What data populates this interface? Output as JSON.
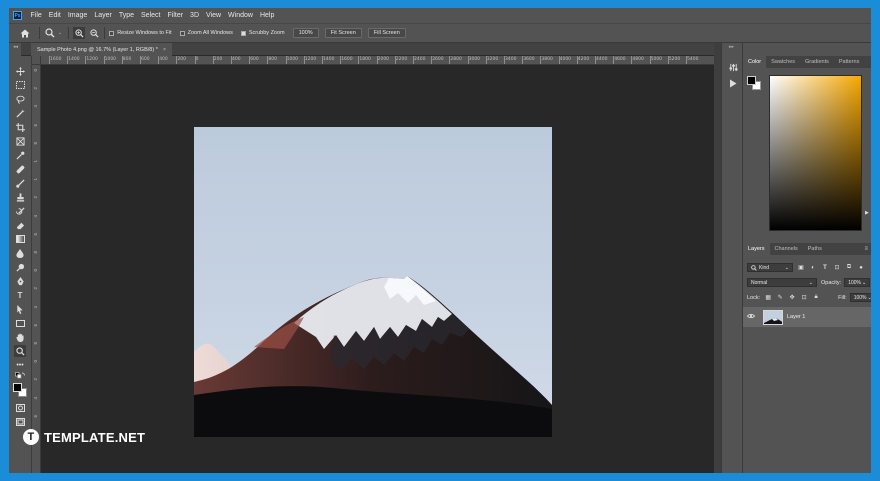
{
  "app": {
    "logo": "Ps"
  },
  "menubar": {
    "items": [
      "File",
      "Edit",
      "Image",
      "Layer",
      "Type",
      "Select",
      "Filter",
      "3D",
      "View",
      "Window",
      "Help"
    ]
  },
  "options": {
    "resize_windows_label": "Resize Windows to Fit",
    "zoom_all_label": "Zoom All Windows",
    "scrubby_zoom_label": "Scrubby Zoom",
    "zoom_value": "100%",
    "fit_screen_label": "Fit Screen",
    "fill_screen_label": "Fill Screen"
  },
  "document_tab": {
    "title": "Sample Photo 4.png @ 16.7% (Layer 1, RGB/8) *",
    "close": "×"
  },
  "hruler": {
    "labels": [
      "1600",
      "1400",
      "1200",
      "1000",
      "800",
      "600",
      "400",
      "200",
      "0",
      "200",
      "400",
      "600",
      "800",
      "1000",
      "1200",
      "1400",
      "1600",
      "1800",
      "2000",
      "2200",
      "2400",
      "2600",
      "2800",
      "3000",
      "3200",
      "3400",
      "3600",
      "3800",
      "4000",
      "4200",
      "4400",
      "4600",
      "4800",
      "5000",
      "5200",
      "5400"
    ]
  },
  "vruler": {
    "labels": [
      "0",
      "2",
      "4",
      "6",
      "8",
      "1",
      "1",
      "2",
      "4",
      "6",
      "8",
      "0",
      "2",
      "4",
      "6",
      "8",
      "0",
      "2",
      "4",
      "6",
      "8"
    ]
  },
  "color_panel": {
    "tabs": [
      "Color",
      "Swatches",
      "Gradients",
      "Patterns"
    ],
    "active": "Color"
  },
  "layers_panel": {
    "tabs": [
      "Layers",
      "Channels",
      "Paths"
    ],
    "active": "Layers",
    "filter_kind": "Kind",
    "blend_mode": "Normal",
    "opacity_label": "Opacity:",
    "opacity_value": "100%",
    "lock_label": "Lock:",
    "fill_label": "Fill:",
    "fill_value": "100%",
    "layer_name": "Layer 1"
  },
  "watermark": {
    "logo_letter": "T",
    "text": "TEMPLATE.NET"
  },
  "icons": [
    "home-icon",
    "zoom-tool-icon",
    "zoom-in-icon",
    "zoom-out-icon",
    "move-icon",
    "marquee-icon",
    "lasso-icon",
    "magic-wand-icon",
    "crop-icon",
    "frame-icon",
    "eyedropper-icon",
    "healing-brush-icon",
    "brush-icon",
    "clone-stamp-icon",
    "history-brush-icon",
    "eraser-icon",
    "gradient-icon",
    "blur-icon",
    "dodge-icon",
    "pen-icon",
    "type-icon",
    "path-select-icon",
    "rectangle-icon",
    "hand-icon",
    "zoom-icon",
    "more-tools-icon",
    "edit-toolbar-icon",
    "quick-mask-icon",
    "screen-mode-icon",
    "eye-icon"
  ]
}
